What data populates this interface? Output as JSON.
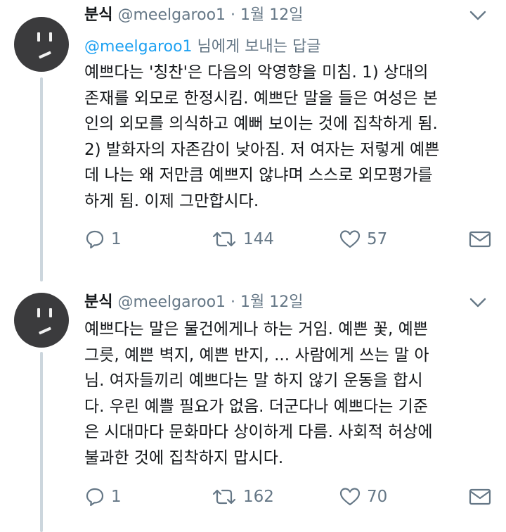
{
  "tweets": [
    {
      "name": "분식",
      "handle": "@meelgaroo1",
      "separator": "·",
      "date": "1월 12일",
      "reply_to_handle": "@meelgaroo1",
      "reply_to_suffix": " 님에게 보내는 답글",
      "text": "예쁘다는 '칭찬'은 다음의 악영향을 미침. 1) 상대의\n존재를 외모로 한정시킴. 예쁘단 말을 들은 여성은 본\n인의 외모를 의식하고 예뻐 보이는 것에 집착하게 됨.\n2) 발화자의 자존감이 낮아짐. 저 여자는 저렇게 예쁜\n데 나는 왜 저만큼 예쁘지 않냐며 스스로 외모평가를\n하게 됨. 이제 그만합시다.",
      "replies": "1",
      "retweets": "144",
      "likes": "57",
      "icons": [
        "chevron-down-icon",
        "reply-icon",
        "retweet-icon",
        "heart-icon",
        "mail-icon"
      ]
    },
    {
      "name": "분식",
      "handle": "@meelgaroo1",
      "separator": "·",
      "date": "1월 12일",
      "text": "예쁘다는 말은 물건에게나 하는 거임. 예쁜 꽃, 예쁜\n그릇, 예쁜 벽지, 예쁜 반지, ... 사람에게 쓰는 말 아\n님. 여자들끼리 예쁘다는 말 하지 않기 운동을 합시\n다. 우린 예쁠 필요가 없음. 더군다나 예쁘다는 기준\n은 시대마다 문화마다 상이하게 다름. 사회적 허상에\n불과한 것에 집착하지 맙시다.",
      "replies": "1",
      "retweets": "162",
      "likes": "70"
    }
  ],
  "colors": {
    "accent": "#1da1f2",
    "muted": "#657786",
    "thread": "#ccd6dd"
  }
}
